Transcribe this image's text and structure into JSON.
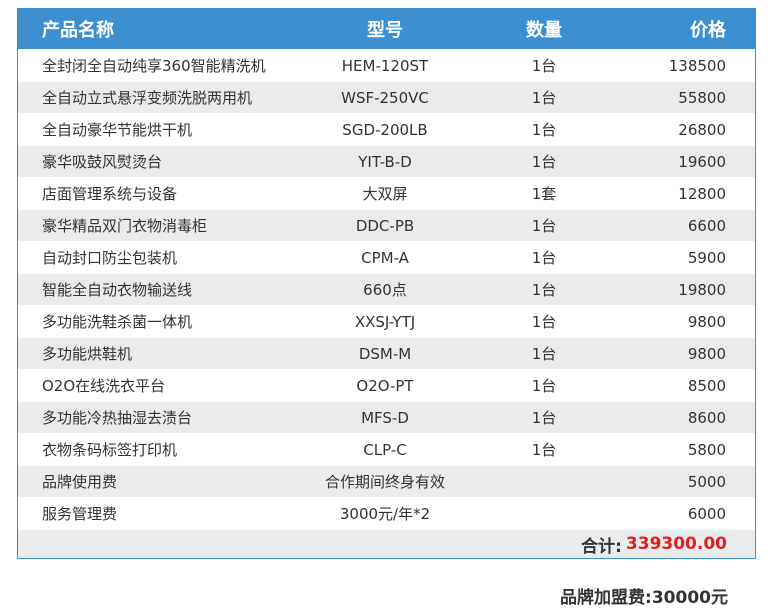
{
  "headers": {
    "name": "产品名称",
    "model": "型号",
    "qty": "数量",
    "price": "价格"
  },
  "rows": [
    {
      "name": "全封闭全自动纯享360智能精洗机",
      "model": "HEM-120ST",
      "qty": "1台",
      "price": "138500"
    },
    {
      "name": "全自动立式悬浮变频洗脱两用机",
      "model": "WSF-250VC",
      "qty": "1台",
      "price": "55800"
    },
    {
      "name": "全自动豪华节能烘干机",
      "model": "SGD-200LB",
      "qty": "1台",
      "price": "26800"
    },
    {
      "name": "豪华吸鼓风熨烫台",
      "model": "YIT-B-D",
      "qty": "1台",
      "price": "19600"
    },
    {
      "name": "店面管理系统与设备",
      "model": "大双屏",
      "qty": "1套",
      "price": "12800"
    },
    {
      "name": "豪华精品双门衣物消毒柜",
      "model": "DDC-PB",
      "qty": "1台",
      "price": "6600"
    },
    {
      "name": "自动封口防尘包装机",
      "model": "CPM-A",
      "qty": "1台",
      "price": "5900"
    },
    {
      "name": "智能全自动衣物输送线",
      "model": "660点",
      "qty": "1台",
      "price": "19800"
    },
    {
      "name": "多功能洗鞋杀菌一体机",
      "model": "XXSJ-YTJ",
      "qty": "1台",
      "price": "9800"
    },
    {
      "name": "多功能烘鞋机",
      "model": "DSM-M",
      "qty": "1台",
      "price": "9800"
    },
    {
      "name": "O2O在线洗衣平台",
      "model": "O2O-PT",
      "qty": "1台",
      "price": "8500"
    },
    {
      "name": "多功能冷热抽湿去渍台",
      "model": "MFS-D",
      "qty": "1台",
      "price": "8600"
    },
    {
      "name": "衣物条码标签打印机",
      "model": "CLP-C",
      "qty": "1台",
      "price": "5800"
    },
    {
      "name": "品牌使用费",
      "model": "合作期间终身有效",
      "qty": "",
      "price": "5000"
    },
    {
      "name": "服务管理费",
      "model": "3000元/年*2",
      "qty": "",
      "price": "6000"
    }
  ],
  "total": {
    "label": "合计:",
    "value": "339300.00"
  },
  "franchise_fee": "品牌加盟费:30000元",
  "colors": {
    "header_bg": "#3c8fd1",
    "stripe": "#e9ebed",
    "total_value": "#e02020"
  }
}
